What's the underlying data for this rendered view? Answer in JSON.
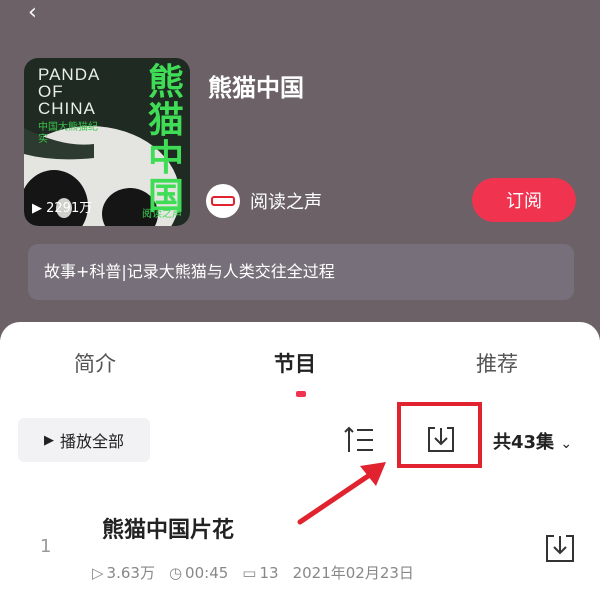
{
  "header": {
    "album_title": "熊猫中国",
    "publisher": "阅读之声",
    "subscribe_label": "订阅",
    "description": "故事+科普|记录大熊猫与人类交往全过程",
    "cover": {
      "title_en_1": "PANDA",
      "title_en_2": "OF",
      "title_en_3": "CHINA",
      "title_zh": "熊猫中国",
      "subtitle_zh": "中国大熊猫纪实",
      "play_count": "▶ 2291万",
      "brand": "阅读之声"
    }
  },
  "tabs": [
    {
      "label": "简介",
      "active": false
    },
    {
      "label": "节目",
      "active": true
    },
    {
      "label": "推荐",
      "active": false
    }
  ],
  "toolbar": {
    "play_all_label": "播放全部",
    "episode_count": "共43集"
  },
  "episodes": [
    {
      "index": "1",
      "title": "熊猫中国片花",
      "plays": "3.63万",
      "duration": "00:45",
      "comments": "13",
      "date": "2021年02月23日"
    }
  ],
  "colors": {
    "accent": "#f0344f",
    "header_bg": "#6b6166",
    "highlight": "#e0232e"
  }
}
